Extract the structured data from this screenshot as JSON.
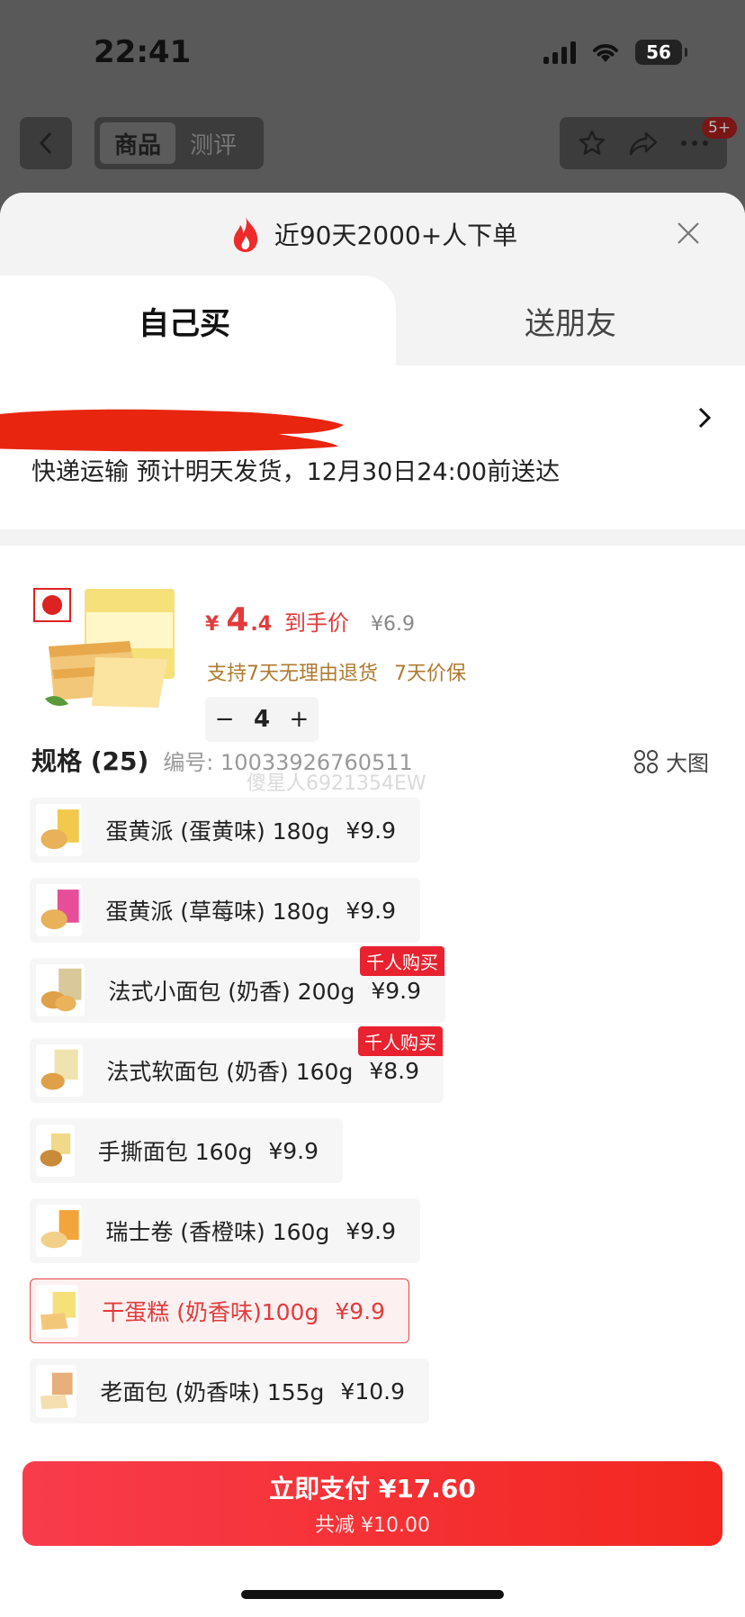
{
  "status_bar": {
    "time": "22:41",
    "battery": "56"
  },
  "top_nav": {
    "tabs": [
      {
        "label": "商品"
      },
      {
        "label": "测评"
      }
    ],
    "badge": "5+"
  },
  "sheet": {
    "header_title": "近90天2000+人下单",
    "buy_tabs": [
      {
        "label": "自己买"
      },
      {
        "label": "送朋友"
      }
    ],
    "shipping": "快递运输 预计明天发货，12月30日24:00前送达"
  },
  "product": {
    "currency": "¥",
    "price_int": "4",
    "price_dec": ".4",
    "price_label": "到手价",
    "original_price": "¥6.9",
    "guarantees": [
      "支持7天无理由退货",
      "7天价保"
    ],
    "quantity": "4",
    "minus": "−",
    "plus": "+"
  },
  "specs": {
    "title": "规格 (25)",
    "code": "编号: 10033926760511",
    "big_pic_label": "大图",
    "watermark": "傻星人6921354EW",
    "items": [
      {
        "name": "蛋黄派 (蛋黄味) 180g",
        "price": "¥9.9"
      },
      {
        "name": "蛋黄派 (草莓味) 180g",
        "price": "¥9.9"
      },
      {
        "name": "法式小面包 (奶香) 200g",
        "price": "¥9.9",
        "tag": "千人购买"
      },
      {
        "name": "法式软面包 (奶香) 160g",
        "price": "¥8.9",
        "tag": "千人购买"
      },
      {
        "name": "手撕面包 160g",
        "price": "¥9.9"
      },
      {
        "name": "瑞士卷 (香橙味) 160g",
        "price": "¥9.9"
      },
      {
        "name": "干蛋糕 (奶香味)100g",
        "price": "¥9.9",
        "selected": true
      },
      {
        "name": "老面包 (奶香味) 155g",
        "price": "¥10.9"
      }
    ]
  },
  "pay": {
    "label": "立即支付 ¥17.60",
    "discount": "共减 ¥10.00"
  },
  "colors": {
    "accent": "#e23b3b",
    "pay_start": "#f83c4c",
    "pay_end": "#f2271f",
    "tag": "#e8232f"
  }
}
